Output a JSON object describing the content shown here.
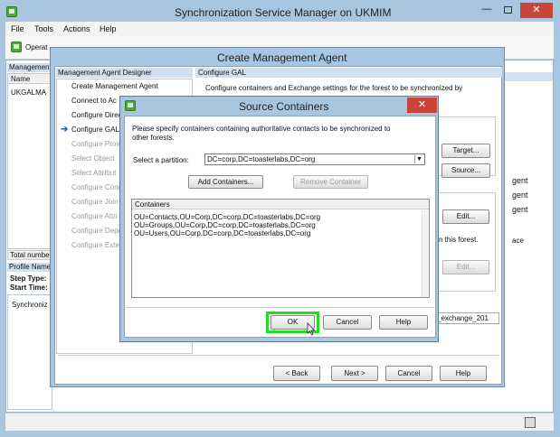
{
  "main_window": {
    "title": "Synchronization Service Manager on UKMIM",
    "menu": [
      "File",
      "Tools",
      "Actions",
      "Help"
    ],
    "toolbar_first": "Operat",
    "left_panel_header": "Management",
    "grid_col_name": "Name",
    "grid_row_1": "UKGALMA",
    "total_number_label": "Total number",
    "profile_name_label": "Profile Name",
    "step_type_label": "Step Type:",
    "start_time_label": "Start Time:",
    "sync_label": "Synchroniz",
    "right_fragments": [
      "gent",
      "gent",
      "gent",
      "ace"
    ]
  },
  "create_ma": {
    "title": "Create Management Agent",
    "designer_header": "Management Agent Designer",
    "steps": [
      {
        "label": "Create Management Agent",
        "enabled": true,
        "arrow": false
      },
      {
        "label": "Connect to Ac",
        "enabled": true,
        "arrow": false
      },
      {
        "label": "Configure Direc",
        "enabled": true,
        "arrow": false
      },
      {
        "label": "Configure GAL",
        "enabled": true,
        "arrow": true
      },
      {
        "label": "Configure Prov",
        "enabled": false,
        "arrow": false
      },
      {
        "label": "Select Object",
        "enabled": false,
        "arrow": false
      },
      {
        "label": "Select Attribut",
        "enabled": false,
        "arrow": false
      },
      {
        "label": "Configure Conn",
        "enabled": false,
        "arrow": false
      },
      {
        "label": "Configure Join",
        "enabled": false,
        "arrow": false
      },
      {
        "label": "Configure Attri",
        "enabled": false,
        "arrow": false
      },
      {
        "label": "Configure Depr",
        "enabled": false,
        "arrow": false
      },
      {
        "label": "Configure Exte",
        "enabled": false,
        "arrow": false
      }
    ],
    "section_header": "Configure GAL",
    "description": "Configure containers and Exchange settings for the forest to be synchronized by",
    "target_button": "Target...",
    "source_button": "Source...",
    "edit_button_1": "Edit...",
    "this_forest_text": "n this forest.",
    "edit_button_2": "Edit...",
    "exchange_fragment": "_exchange_201",
    "back_button": "< Back",
    "next_button": "Next >",
    "cancel_button": "Cancel",
    "help_button": "Help"
  },
  "source_containers": {
    "title": "Source Containers",
    "instructions": "Please specify containers containing authoritative contacts to be synchronized to other forests.",
    "partition_label": "Select a partition:",
    "partition_value": "DC=corp,DC=toasterlabs,DC=org",
    "add_button": "Add Containers...",
    "remove_button": "Remove Container",
    "list_header": "Containers",
    "containers": [
      "OU=Contacts,OU=Corp,DC=corp,DC=toasterlabs,DC=org",
      "OU=Groups,OU=Corp,DC=corp,DC=toasterlabs,DC=org",
      "OU=Users,OU=Corp,DC=corp,DC=toasterlabs,DC=org"
    ],
    "ok_button": "OK",
    "cancel_button": "Cancel",
    "help_button": "Help"
  },
  "colors": {
    "chrome": "#a8c6e0",
    "close_red": "#c9453a",
    "ok_highlight": "#22dd22",
    "panel_header": "#cfe0f0"
  }
}
